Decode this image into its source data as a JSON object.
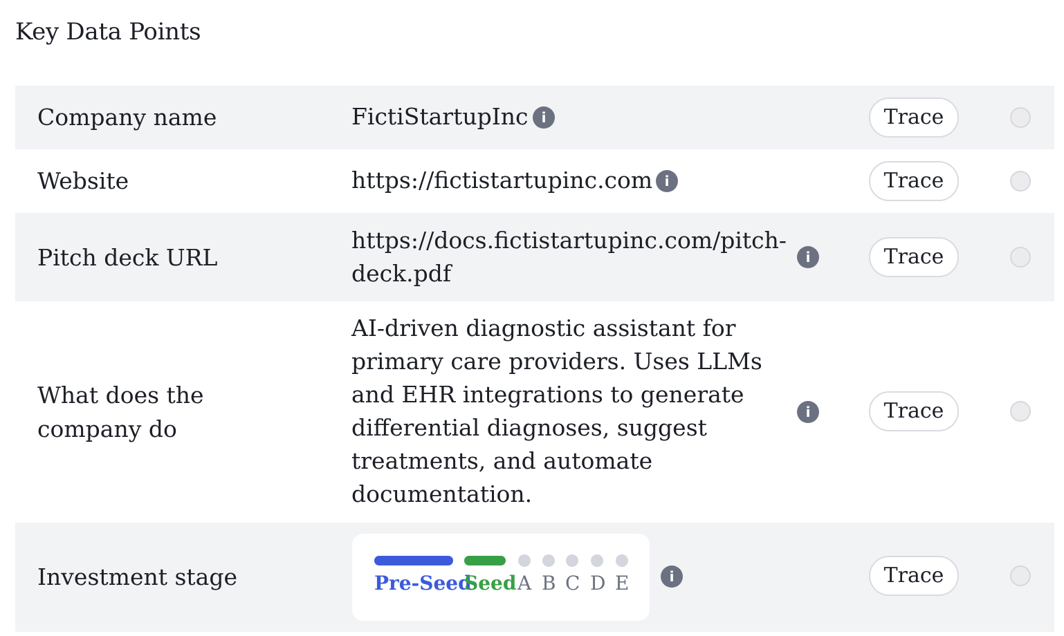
{
  "page": {
    "title": "Key Data Points"
  },
  "action_label": "Trace",
  "rows": [
    {
      "label": "Company name",
      "value": "FictiStartupInc"
    },
    {
      "label": "Website",
      "value": "https://fictistartupinc.com"
    },
    {
      "label": "Pitch deck URL",
      "value": "https://docs.fictistartupinc.com/pitch-deck.pdf"
    },
    {
      "label": "What does the company do",
      "value": "AI-driven diagnostic assistant for primary care providers. Uses LLMs and EHR integrations to generate differential diagnoses, suggest treatments, and automate documentation."
    },
    {
      "label": "Investment stage"
    }
  ],
  "stages": [
    {
      "label": "Pre-Seed",
      "state": "active",
      "color": "#3b5bdb"
    },
    {
      "label": "Seed",
      "state": "current",
      "color": "#37a046"
    },
    {
      "label": "A",
      "state": "inactive",
      "color": "#6b7280"
    },
    {
      "label": "B",
      "state": "inactive",
      "color": "#6b7280"
    },
    {
      "label": "C",
      "state": "inactive",
      "color": "#6b7280"
    },
    {
      "label": "D",
      "state": "inactive",
      "color": "#6b7280"
    },
    {
      "label": "E",
      "state": "inactive",
      "color": "#6b7280"
    }
  ],
  "colors": {
    "row_shade": "#f2f3f5",
    "info_icon": "#6b7180",
    "inactive_dot": "#d4d6dd"
  }
}
